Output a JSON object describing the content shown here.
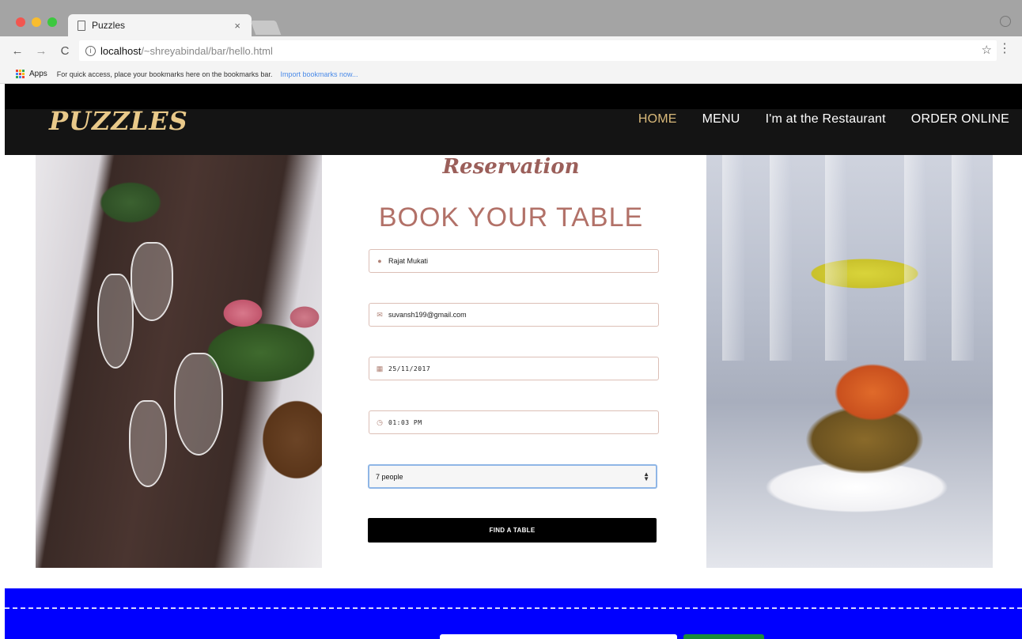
{
  "browser": {
    "tab_title": "Puzzles",
    "tab_close": "×",
    "url_host": "localhost",
    "url_path": "/~shreyabindal/bar/hello.html",
    "bookmarks_apps": "Apps",
    "bookmarks_hint": "For quick access, place your bookmarks here on the bookmarks bar.",
    "bookmarks_import": "Import bookmarks now..."
  },
  "site": {
    "logo": "PUZZLES",
    "nav": [
      "HOME",
      "MENU",
      "I'm at the Restaurant",
      "ORDER ONLINE"
    ],
    "active_nav": "HOME",
    "accent_color": "#d9b97a"
  },
  "reservation": {
    "script_title": "Reservation",
    "title": "BOOK YOUR TABLE",
    "name_value": "Rajat Mukati",
    "email_value": "suvansh199@gmail.com",
    "date_value": "25/11/2017",
    "time_value": "01:03 PM",
    "party_value": "7 people",
    "submit_label": "FIND A TABLE"
  },
  "icons": {
    "name": "user-icon",
    "email": "envelope-icon",
    "date": "calendar-icon",
    "time": "clock-icon"
  }
}
